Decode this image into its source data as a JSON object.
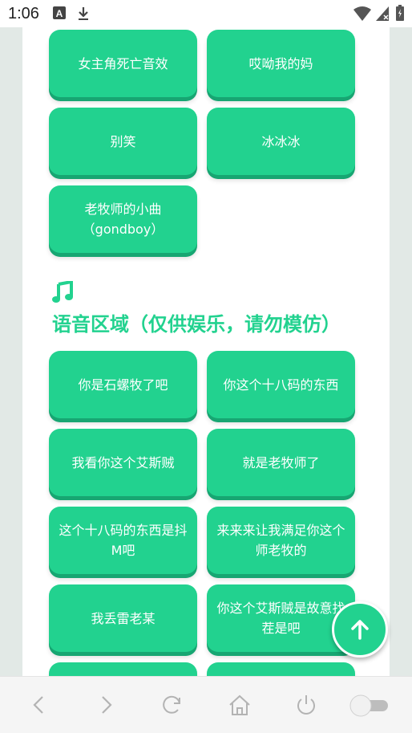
{
  "status_bar": {
    "time": "1:06",
    "icons": [
      "keyboard-a-icon",
      "download-icon",
      "wifi-icon",
      "signal-icon",
      "battery-icon"
    ]
  },
  "sound_buttons_top": [
    "女主角死亡音效",
    "哎呦我的妈",
    "别笑",
    "冰冰冰",
    "老牧师的小曲\n（gondboy）"
  ],
  "voice_section": {
    "icon": "music-note-icon",
    "title": "语音区域（仅供娱乐，请勿模仿）"
  },
  "voice_buttons": [
    "你是石螺牧了吧",
    "你这个十八码的东西",
    "我看你这个艾斯贼",
    "就是老牧师了",
    "这个十八码的东西是抖M吧",
    "来来来让我满足你这个师老牧的",
    "我丢雷老某",
    "你这个艾斯贼是故意找茬是吧",
    "",
    ""
  ],
  "fab": {
    "icon": "arrow-up-icon"
  },
  "navbar": {
    "icons": [
      "back-icon",
      "forward-icon",
      "refresh-icon",
      "home-icon",
      "power-icon",
      "toggle-switch"
    ]
  },
  "colors": {
    "accent": "#22d28f",
    "accent_shadow": "#17a672",
    "page_bg": "#e2e9e6"
  }
}
